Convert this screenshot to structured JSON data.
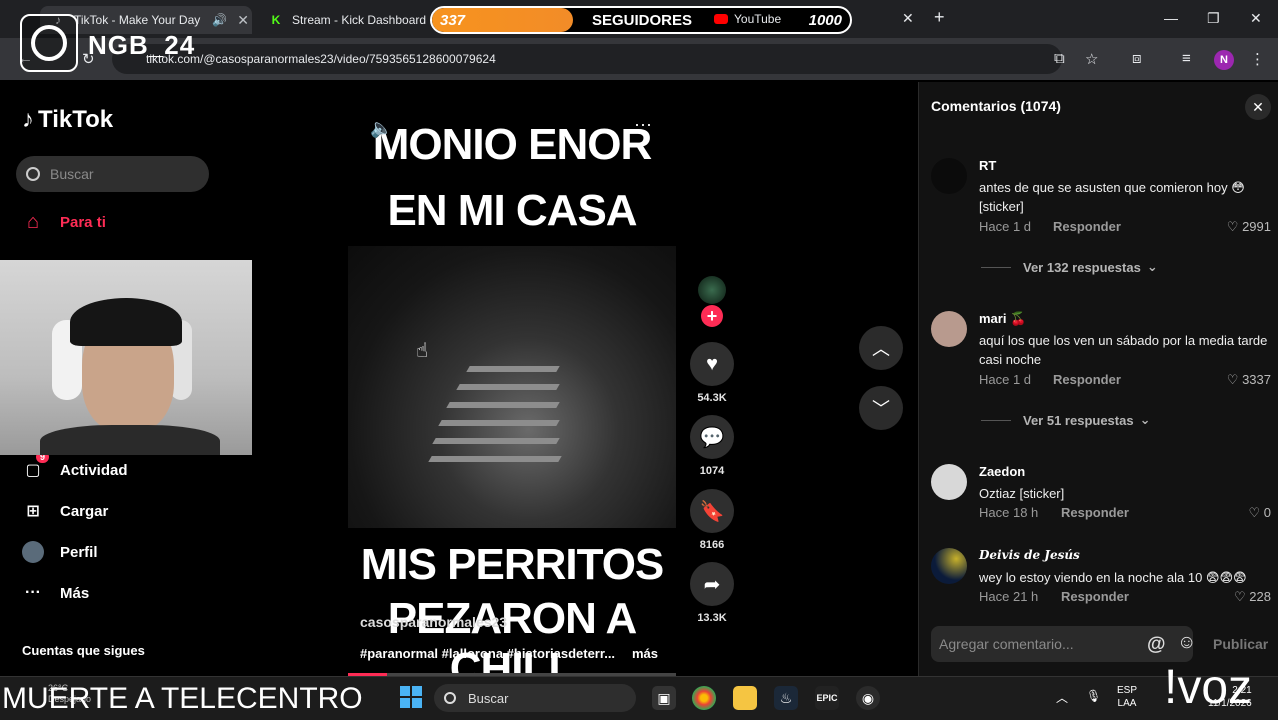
{
  "browser": {
    "tabs": [
      {
        "label": "TikTok - Make Your Day"
      },
      {
        "label": "Stream - Kick Dashboard"
      },
      {
        "label": "YouTube"
      }
    ],
    "new_tab": "+",
    "url": "tiktok.com/@casosparanormales23/video/7593565128600079624",
    "profile_initial": "N",
    "window_controls": {
      "min": "—",
      "max": "❐",
      "close": "✕"
    }
  },
  "overlay": {
    "follower_count": "337",
    "follower_label": "SEGUIDORES",
    "follower_goal": "1000",
    "progress_fraction": 0.337,
    "brand": "NGB_24",
    "ticker": "MUERTE A TELECENTRO",
    "voz": "!voz"
  },
  "tiktok": {
    "logo": "TikTok",
    "search_placeholder": "Buscar",
    "nav": [
      {
        "label": "Para ti",
        "icon": "home-icon"
      },
      {
        "label": "Actividad",
        "icon": "inbox-icon",
        "badge": "9"
      },
      {
        "label": "Cargar",
        "icon": "upload-icon"
      },
      {
        "label": "Perfil",
        "icon": "profile-icon"
      },
      {
        "label": "Más",
        "icon": "more-icon"
      }
    ],
    "following_title": "Cuentas que sigues"
  },
  "video": {
    "caption_top_1": "MONIO ENOR",
    "caption_top_2": "EN MI CASA",
    "caption_bottom_1": "MIS PERRITOS",
    "caption_bottom_2": "PEZARON A CHILL",
    "author": "casosparanormales23",
    "description": "#paranormal #lallorona #historiasdeterr...",
    "more": "más",
    "progress_fraction": 0.12,
    "actions": {
      "likes": "54.3K",
      "comments": "1074",
      "saves": "8166",
      "shares": "13.3K"
    }
  },
  "comments": {
    "title": "Comentarios (1074)",
    "items": [
      {
        "user": "RT",
        "text": "antes de que se asusten que comieron hoy 😳 [sticker]",
        "time": "Hace 1 d",
        "reply": "Responder",
        "likes": "2991",
        "replies_link": "Ver 132 respuestas"
      },
      {
        "user": "mari 🍒",
        "text": "aquí los que los ven un sábado por la media tarde casi noche",
        "time": "Hace 1 d",
        "reply": "Responder",
        "likes": "3337",
        "replies_link": "Ver 51 respuestas"
      },
      {
        "user": "Zaedon",
        "text": "Oztiaz [sticker]",
        "time": "Hace 18 h",
        "reply": "Responder",
        "likes": "0"
      },
      {
        "user": "Deivis de Jesús",
        "text": "wey lo estoy viendo en la noche ala 10 😨😨😨",
        "time": "Hace 21 h",
        "reply": "Responder",
        "likes": "228"
      }
    ],
    "input_placeholder": "Agregar comentario...",
    "at_symbol": "@",
    "publish": "Publicar"
  },
  "taskbar": {
    "search": "Buscar",
    "weather": "26°C\nDespejado",
    "lang_1": "ESP",
    "lang_2": "LAA",
    "time": "2:21",
    "date": "11/1/2026"
  }
}
